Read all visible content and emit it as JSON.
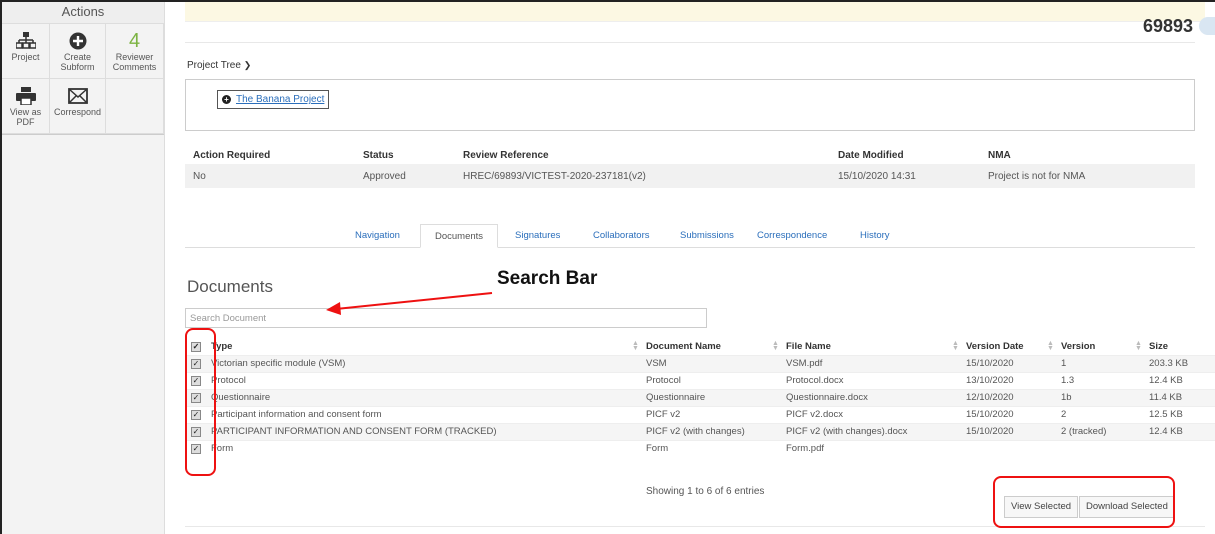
{
  "sidebar": {
    "title": "Actions",
    "actions": [
      {
        "label": "Project",
        "icon": "project-tree-icon"
      },
      {
        "label": "Create Subform",
        "icon": "plus-circle-icon"
      },
      {
        "label": "Reviewer Comments",
        "count": "4"
      },
      {
        "label": "View as PDF",
        "icon": "printer-icon"
      },
      {
        "label": "Correspond",
        "icon": "envelope-icon"
      }
    ]
  },
  "header": {
    "project_number": "69893"
  },
  "project_tree": {
    "label": "Project Tree",
    "node": "The Banana Project"
  },
  "info": {
    "headers": [
      "Action Required",
      "Status",
      "Review Reference",
      "Date Modified",
      "NMA"
    ],
    "values": [
      "No",
      "Approved",
      "HREC/69893/VICTEST-2020-237181(v2)",
      "15/10/2020 14:31",
      "Project is not for NMA"
    ]
  },
  "tabs": [
    "Navigation",
    "Documents",
    "Signatures",
    "Collaborators",
    "Submissions",
    "Correspondence",
    "History"
  ],
  "documents": {
    "title": "Documents",
    "search_placeholder": "Search Document",
    "columns": [
      "Type",
      "Document Name",
      "File Name",
      "Version Date",
      "Version",
      "Size"
    ],
    "rows": [
      [
        "Victorian specific module (VSM)",
        "VSM",
        "VSM.pdf",
        "15/10/2020",
        "1",
        "203.3 KB"
      ],
      [
        "Protocol",
        "Protocol",
        "Protocol.docx",
        "13/10/2020",
        "1.3",
        "12.4 KB"
      ],
      [
        "Questionnaire",
        "Questionnaire",
        "Questionnaire.docx",
        "12/10/2020",
        "1b",
        "11.4 KB"
      ],
      [
        "Participant information and consent form",
        "PICF v2",
        "PICF v2.docx",
        "15/10/2020",
        "2",
        "12.5 KB"
      ],
      [
        "PARTICIPANT INFORMATION AND CONSENT FORM (TRACKED)",
        "PICF v2 (with changes)",
        "PICF v2 (with changes).docx",
        "15/10/2020",
        "2 (tracked)",
        "12.4 KB"
      ],
      [
        "Form",
        "Form",
        "Form.pdf",
        "",
        "",
        ""
      ]
    ],
    "showing": "Showing 1 to 6 of 6 entries",
    "view_selected": "View Selected",
    "download_selected": "Download Selected"
  },
  "annotation": {
    "label": "Search Bar"
  },
  "colors": {
    "annotation_red": "#e11111",
    "link_blue": "#2a6ebb",
    "notice_yellow": "#fcf8e3"
  }
}
